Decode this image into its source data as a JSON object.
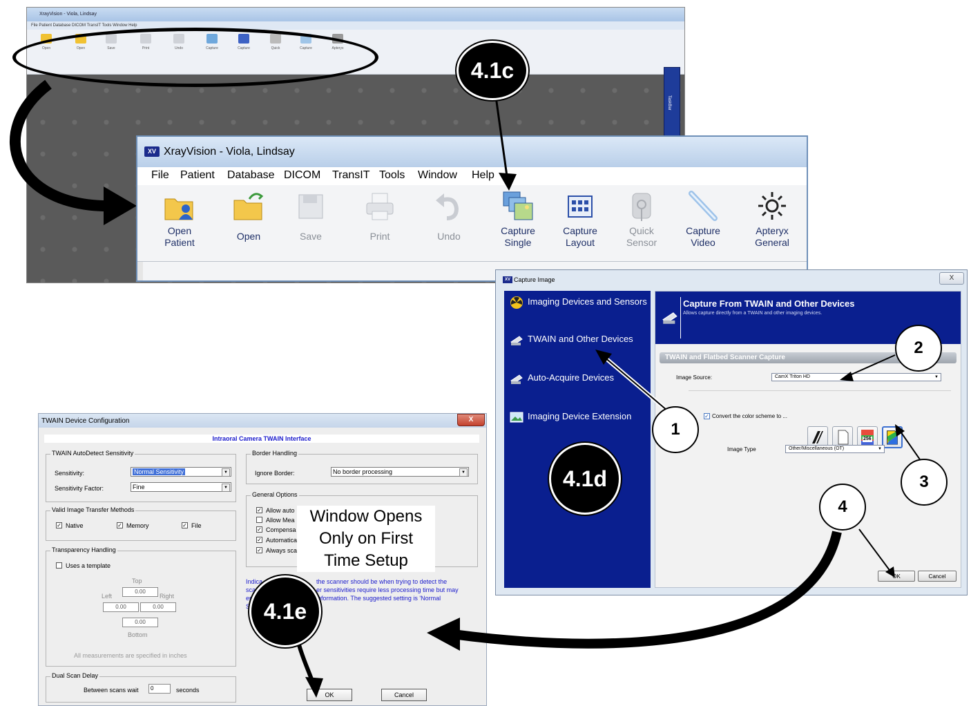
{
  "background_window": {
    "title": "XrayVision - Viola, Lindsay",
    "menu": "File   Patient   Database   DICOM   TransIT   Tools   Window   Help",
    "side_tab": "TaskBar"
  },
  "main_window": {
    "logo": "XV",
    "title": "XrayVision - Viola, Lindsay",
    "menu": [
      "File",
      "Patient",
      "Database",
      "DICOM",
      "TransIT",
      "Tools",
      "Window",
      "Help"
    ],
    "toolbar": [
      {
        "line1": "Open",
        "line2": "Patient"
      },
      {
        "line1": "Open",
        "line2": ""
      },
      {
        "line1": "Save",
        "line2": ""
      },
      {
        "line1": "Print",
        "line2": ""
      },
      {
        "line1": "Undo",
        "line2": ""
      },
      {
        "line1": "Capture",
        "line2": "Single"
      },
      {
        "line1": "Capture",
        "line2": "Layout"
      },
      {
        "line1": "Quick",
        "line2": "Sensor"
      },
      {
        "line1": "Capture",
        "line2": "Video"
      },
      {
        "line1": "Apteryx",
        "line2": "General"
      }
    ]
  },
  "capture_dialog": {
    "title": "Capture Image",
    "logo": "XV",
    "close": "X",
    "sidebar": [
      "Imaging Devices and Sensors",
      "TWAIN and Other Devices",
      "Auto-Acquire Devices",
      "Imaging Device Extension"
    ],
    "header_title": "Capture From TWAIN and Other Devices",
    "header_sub": "Allows capture directly from a TWAIN and other imaging devices.",
    "section": "TWAIN and Flatbed Scanner Capture",
    "image_source_label": "Image Source:",
    "image_source_value": "CamX Triton HD",
    "convert_label": "Convert the color scheme to ...",
    "scheme_256": "256",
    "image_type_label": "Image Type",
    "image_type_value": "Other/Miscellaneous (OT)",
    "ok": "OK",
    "cancel": "Cancel"
  },
  "twain_dialog": {
    "title": "TWAIN Device Configuration",
    "close": "X",
    "banner": "Intraoral Camera TWAIN Interface",
    "autodetect_title": "TWAIN AutoDetect Sensitivity",
    "sensitivity_label": "Sensitivity:",
    "sensitivity_value": "Normal Sensitivity",
    "factor_label": "Sensitivity Factor:",
    "factor_value": "Fine",
    "transfer_title": "Valid Image Transfer Methods",
    "native": "Native",
    "memory": "Memory",
    "file": "File",
    "transparency_title": "Transparency Handling",
    "template": "Uses a template",
    "top": "Top",
    "left": "Left",
    "right": "Right",
    "bottom": "Bottom",
    "zero": "0.00",
    "inches_note": "All measurements are specified in inches",
    "dual_title": "Dual Scan Delay",
    "between_label": "Between scans wait",
    "between_value": "0",
    "seconds": "seconds",
    "border_title": "Border Handling",
    "ignore_label": "Ignore Border:",
    "ignore_value": "No border processing",
    "general_title": "General Options",
    "general_options": [
      "Allow auto",
      "Allow Mea",
      "Compensa",
      "Automatica",
      "Always sca"
    ],
    "desc_1": "Indica",
    "desc_1b": "the scanner should be when trying to detect the",
    "desc_2": "scan",
    "desc_2b": "er sensitivities require less processing time but may",
    "desc_3": "en",
    "desc_3b": "information.  The suggested setting is 'Normal",
    "desc_4": "S",
    "ok": "OK",
    "cancel": "Cancel"
  },
  "annotations": {
    "step_c": "4.1c",
    "step_d": "4.1d",
    "step_e": "4.1e",
    "callouts": [
      "1",
      "2",
      "3",
      "4"
    ],
    "note": [
      "Window Opens",
      "Only on First",
      "Time Setup"
    ]
  }
}
